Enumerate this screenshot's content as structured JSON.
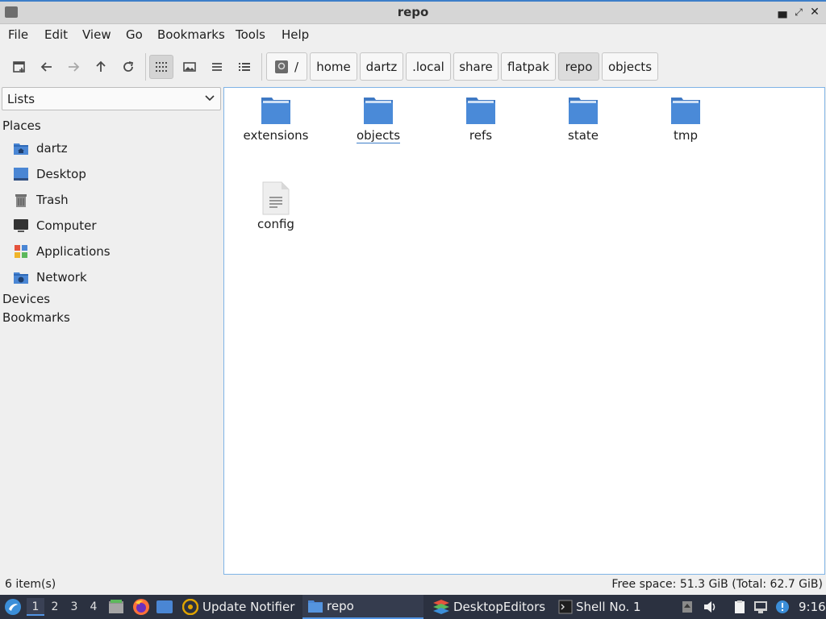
{
  "window": {
    "title": "repo"
  },
  "menu": [
    "File",
    "Edit",
    "View",
    "Go",
    "Bookmarks",
    "Tools",
    "Help"
  ],
  "path": [
    "/",
    "home",
    "dartz",
    ".local",
    "share",
    "flatpak",
    "repo",
    "objects"
  ],
  "sidebar": {
    "selector": "Lists",
    "places_label": "Places",
    "places": [
      {
        "label": "dartz",
        "icon": "home-folder-icon"
      },
      {
        "label": "Desktop",
        "icon": "desktop-icon"
      },
      {
        "label": "Trash",
        "icon": "trash-icon"
      },
      {
        "label": "Computer",
        "icon": "computer-icon"
      },
      {
        "label": "Applications",
        "icon": "applications-icon"
      },
      {
        "label": "Network",
        "icon": "network-icon"
      }
    ],
    "devices_label": "Devices",
    "bookmarks_label": "Bookmarks"
  },
  "files": [
    {
      "name": "extensions",
      "type": "folder"
    },
    {
      "name": "objects",
      "type": "folder"
    },
    {
      "name": "refs",
      "type": "folder"
    },
    {
      "name": "state",
      "type": "folder"
    },
    {
      "name": "tmp",
      "type": "folder"
    },
    {
      "name": "config",
      "type": "file"
    }
  ],
  "status": {
    "items": "6 item(s)",
    "free_space": "Free space: 51.3 GiB (Total: 62.7 GiB)"
  },
  "taskbar": {
    "workspaces": [
      "1",
      "2",
      "3",
      "4"
    ],
    "tasks": [
      "Update Notifier",
      "repo",
      "DesktopEditors",
      "Shell No. 1"
    ],
    "clock": "9:16"
  },
  "colors": {
    "accent": "#3d7ec9",
    "folder": "#4a86d4",
    "taskbar": "#2b3140"
  }
}
